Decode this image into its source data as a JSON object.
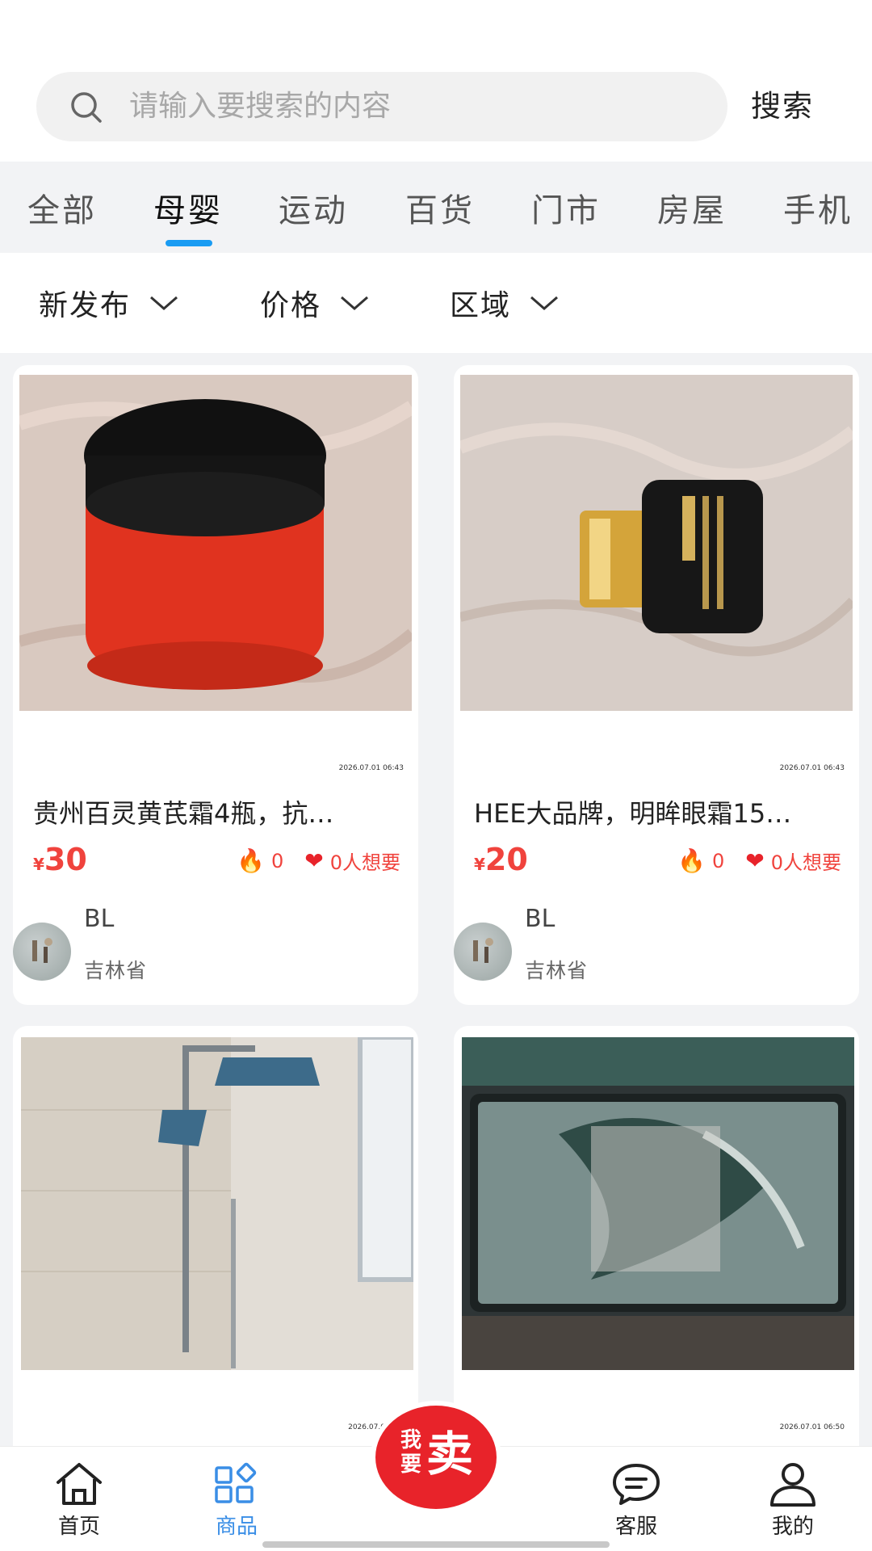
{
  "search": {
    "placeholder": "请输入要搜索的内容",
    "button_label": "搜索"
  },
  "categories": {
    "items": [
      "全部",
      "母婴",
      "运动",
      "百货",
      "门市",
      "房屋",
      "手机"
    ],
    "active_index": 1
  },
  "filters": [
    "新发布",
    "价格",
    "区域"
  ],
  "products": [
    {
      "date": "2026.07.01 06:43",
      "title": "贵州百灵黄芪霜4瓶，抗…",
      "price_symbol": "¥",
      "price": "30",
      "views": "0",
      "wants": "0人想要",
      "seller": "BL",
      "region": "吉林省"
    },
    {
      "date": "2026.07.01 06:43",
      "title": "HEE大品牌，明眸眼霜15…",
      "price_symbol": "¥",
      "price": "20",
      "views": "0",
      "wants": "0人想要",
      "seller": "BL",
      "region": "吉林省"
    },
    {
      "date": "2026.07.01 06:"
    },
    {
      "date": "2026.07.01 06:50"
    }
  ],
  "sell_button": {
    "small": "我要",
    "big": "卖"
  },
  "bottom_nav": {
    "home": "首页",
    "goods": "商品",
    "service": "客服",
    "mine": "我的"
  },
  "colors": {
    "accent": "#1a9cf3",
    "price": "#f0433d",
    "sell": "#e8232a",
    "nav_active": "#3a8ee6"
  }
}
